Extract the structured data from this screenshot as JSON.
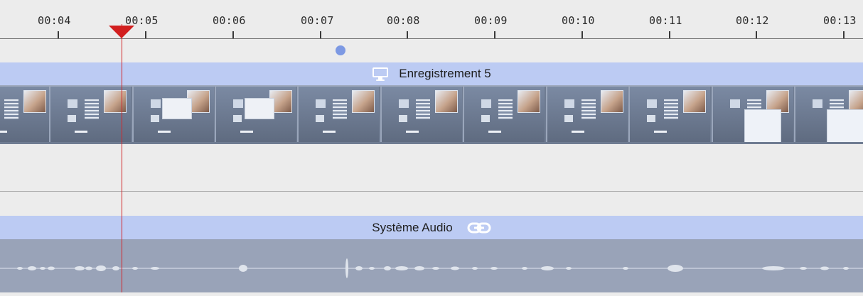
{
  "ruler": {
    "ticks": [
      "00:04",
      "00:05",
      "00:06",
      "00:07",
      "00:08",
      "00:09",
      "00:10",
      "00:11",
      "00:12",
      "00:13"
    ]
  },
  "video_track": {
    "clip_title": "Enregistrement 5",
    "clip_icon": "display-icon"
  },
  "audio_track": {
    "clip_title": "Système Audio",
    "clip_icon": "link-icon"
  },
  "colors": {
    "clip_header": "#bccbf3",
    "playhead": "#d21f1f",
    "marker": "#7d99e3",
    "waveform_bg": "#99a3b8"
  }
}
